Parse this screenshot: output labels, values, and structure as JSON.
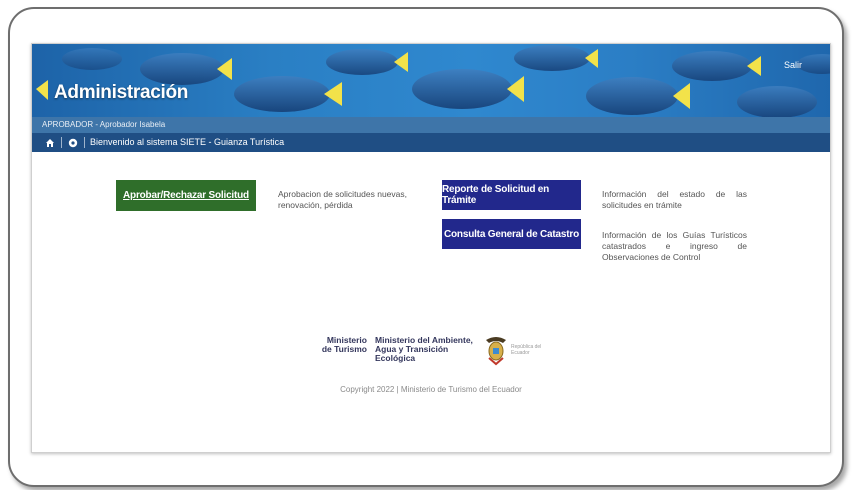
{
  "header": {
    "title": "Administración",
    "logout_label": "Salir"
  },
  "user_bar": {
    "text": "APROBADOR - Aprobador Isabela"
  },
  "nav": {
    "welcome": "Bienvenido al sistema SIETE - Guianza Turística",
    "home_icon": "home-icon",
    "settings_icon": "gear-icon"
  },
  "actions": [
    {
      "label": "Aprobar/Rechazar Solicitud",
      "description": "Aprobacion de solicitudes nuevas, renovación, pérdida",
      "color": "#2f6e2a"
    },
    {
      "label": "Reporte de Solicitud en Trámite",
      "description": "Información del estado de las solicitudes en trámite",
      "color": "#22288c"
    },
    {
      "label": "Consulta General de Catastro",
      "description": "Información de los Guías Turísticos catastrados e ingreso de Observaciones de Control",
      "color": "#22288c"
    }
  ],
  "footer": {
    "ministry1": "Ministerio de Turismo",
    "ministry2": "Ministerio del Ambiente, Agua y Transición Ecológica",
    "republic": "República del Ecuador",
    "copyright": "Copyright 2022 | Ministerio de Turismo del Ecuador"
  }
}
